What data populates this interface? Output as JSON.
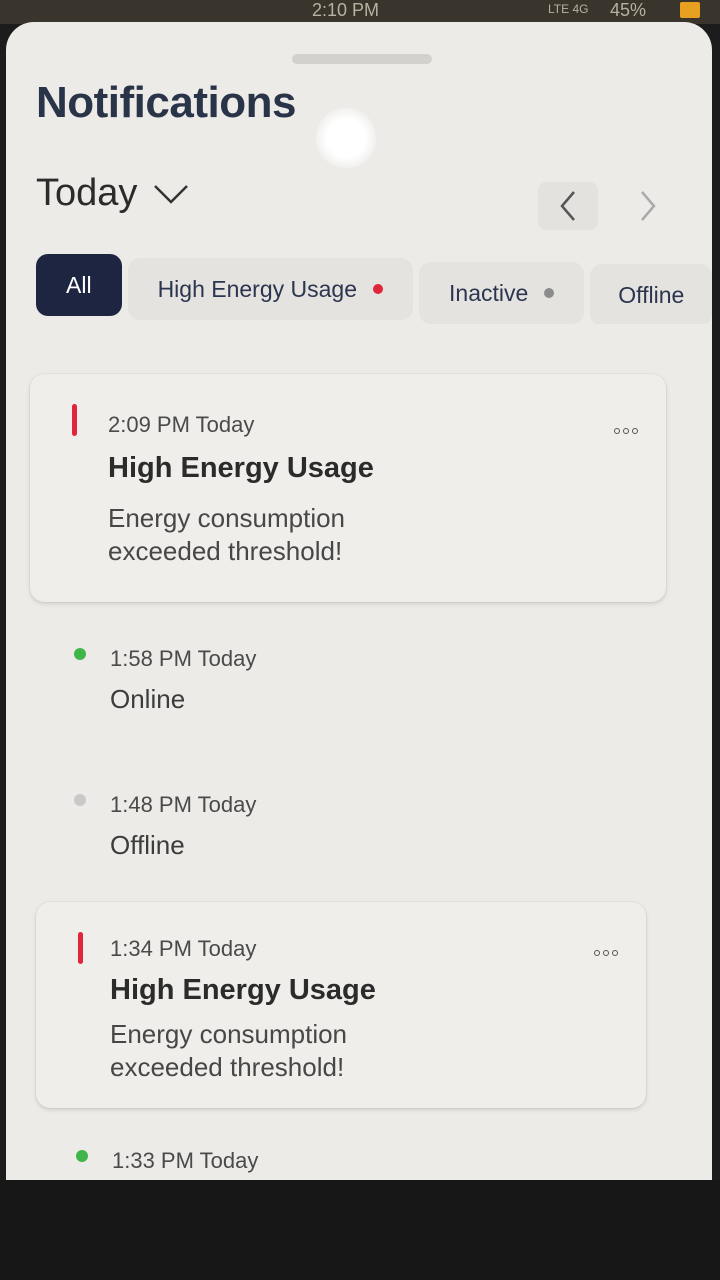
{
  "status_bar": {
    "carrier": "",
    "time": "2:10 PM",
    "network": "LTE 4G",
    "battery": "45%"
  },
  "header": {
    "title": "Notifications",
    "date_filter": "Today"
  },
  "filters": [
    {
      "label": "All",
      "active": true,
      "dot_color": ""
    },
    {
      "label": "High Energy Usage",
      "active": false,
      "dot_color": "#e0263a"
    },
    {
      "label": "Inactive",
      "active": false,
      "dot_color": "#8c8c8c"
    },
    {
      "label": "Offline",
      "active": false,
      "dot_color": ""
    }
  ],
  "notifications": [
    {
      "type": "alert",
      "time": "2:09 PM Today",
      "title": "High Energy Usage",
      "body_line1": "Energy consumption",
      "body_line2": "exceeded threshold!",
      "marker_color": "#e0263a"
    },
    {
      "type": "status",
      "time": "1:58 PM Today",
      "title": "Online",
      "marker_color": "#3fb54a"
    },
    {
      "type": "status",
      "time": "1:48 PM Today",
      "title": "Offline",
      "marker_color": "#c9c9c9"
    },
    {
      "type": "alert",
      "time": "1:34 PM Today",
      "title": "High Energy Usage",
      "body_line1": "Energy consumption",
      "body_line2": "exceeded threshold!",
      "marker_color": "#e0263a"
    },
    {
      "type": "status",
      "time": "1:33 PM Today",
      "title": "",
      "marker_color": "#3fb54a"
    }
  ],
  "icons": {
    "date_chevron": "chevron-down-icon",
    "prev": "chevron-left-icon",
    "next": "chevron-right-icon",
    "more": "more-options-icon"
  }
}
